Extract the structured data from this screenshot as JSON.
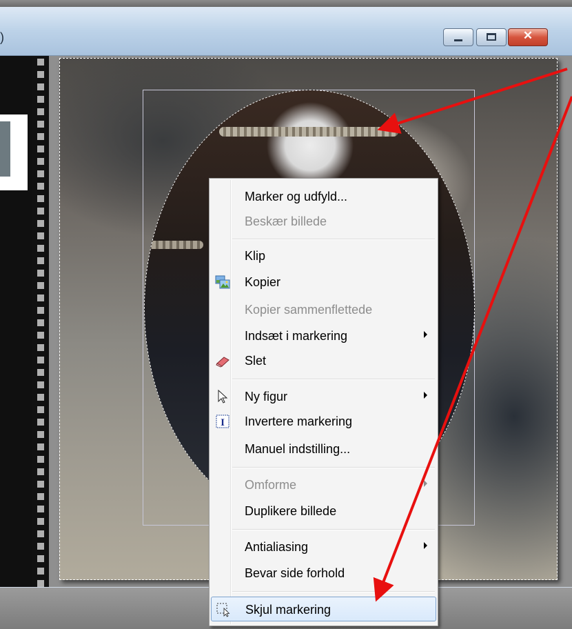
{
  "window": {
    "title": ")",
    "buttons": {
      "minimize": "",
      "maximize": "",
      "close": "✕"
    }
  },
  "menu": {
    "items": [
      {
        "label": "Marker og udfyld...",
        "disabled": false
      },
      {
        "label": "Beskær billede",
        "disabled": true
      },
      {
        "label": "Klip",
        "disabled": false
      },
      {
        "label": "Kopier",
        "disabled": false,
        "icon": "copy-image-icon"
      },
      {
        "label": "Kopier sammenflettede",
        "disabled": true
      },
      {
        "label": "Indsæt i markering",
        "disabled": false,
        "submenu": true
      },
      {
        "label": "Slet",
        "disabled": false,
        "icon": "eraser-icon"
      },
      {
        "label": "Ny figur",
        "disabled": false,
        "submenu": true,
        "icon": "pointer-icon"
      },
      {
        "label": "Invertere markering",
        "disabled": false,
        "icon": "invert-selection-icon"
      },
      {
        "label": "Manuel indstilling...",
        "disabled": false
      },
      {
        "label": "Omforme",
        "disabled": true,
        "submenu": true
      },
      {
        "label": "Duplikere billede",
        "disabled": false
      },
      {
        "label": "Antialiasing",
        "disabled": false,
        "submenu": true
      },
      {
        "label": "Bevar side forhold",
        "disabled": false
      },
      {
        "label": "Skjul markering",
        "disabled": false,
        "highlighted": true,
        "icon": "hide-selection-icon"
      }
    ]
  },
  "colors": {
    "arrow": "#e8100f",
    "highlight_border": "#7da2ce",
    "close_button": "#d6553e"
  }
}
